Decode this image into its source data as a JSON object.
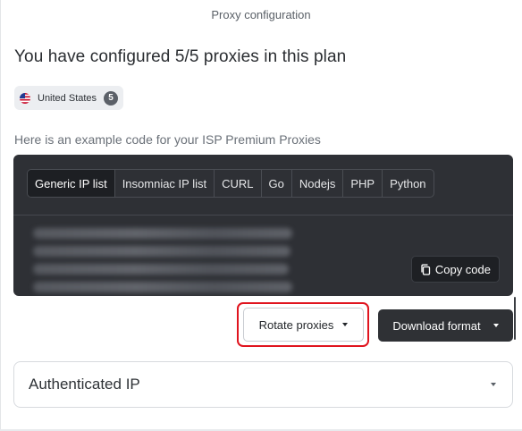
{
  "header": {
    "title": "Proxy configuration"
  },
  "summary": {
    "headline": "You have configured 5/5 proxies in this plan"
  },
  "location_chip": {
    "label": "United States",
    "count": "5",
    "flag_icon": "us-flag-icon"
  },
  "code_section": {
    "subheading": "Here is an example code for your ISP Premium Proxies",
    "tabs": [
      {
        "label": "Generic IP list",
        "active": true
      },
      {
        "label": "Insomniac IP list",
        "active": false
      },
      {
        "label": "CURL",
        "active": false
      },
      {
        "label": "Go",
        "active": false
      },
      {
        "label": "Nodejs",
        "active": false
      },
      {
        "label": "PHP",
        "active": false
      },
      {
        "label": "Python",
        "active": false
      }
    ],
    "copy_label": "Copy code"
  },
  "actions": {
    "rotate_label": "Rotate proxies",
    "download_label": "Download format"
  },
  "auth_section": {
    "title": "Authenticated IP"
  },
  "colors": {
    "panel_bg": "#2e3035",
    "active_tab_bg": "#1d1f23",
    "highlight_outline": "#e0141e",
    "download_bg": "#2f3135"
  }
}
